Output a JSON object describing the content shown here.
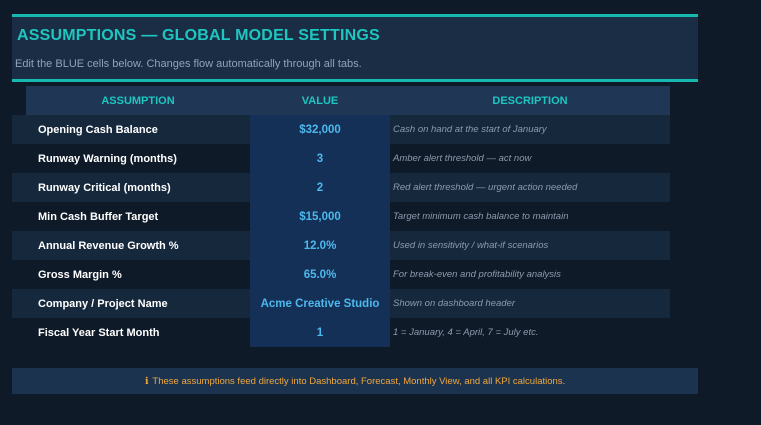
{
  "header": {
    "title": "ASSUMPTIONS  —  GLOBAL MODEL SETTINGS",
    "subtitle": "Edit the BLUE cells below. Changes flow automatically through all tabs."
  },
  "table": {
    "columns": {
      "assumption": "ASSUMPTION",
      "value": "VALUE",
      "description": "DESCRIPTION"
    },
    "rows": [
      {
        "label": "Opening Cash Balance",
        "value": "$32,000",
        "description": "Cash on hand at the start of January"
      },
      {
        "label": "Runway Warning (months)",
        "value": "3",
        "description": "Amber alert threshold — act now"
      },
      {
        "label": "Runway Critical (months)",
        "value": "2",
        "description": "Red alert threshold — urgent action needed"
      },
      {
        "label": "Min Cash Buffer Target",
        "value": "$15,000",
        "description": "Target minimum cash balance to maintain"
      },
      {
        "label": "Annual Revenue Growth %",
        "value": "12.0%",
        "description": "Used in sensitivity / what-if scenarios"
      },
      {
        "label": "Gross Margin %",
        "value": "65.0%",
        "description": "For break-even and profitability analysis"
      },
      {
        "label": "Company / Project Name",
        "value": "Acme Creative Studio",
        "description": "Shown on dashboard header"
      },
      {
        "label": "Fiscal Year Start Month",
        "value": "1",
        "description": "1 = January, 4 = April, 7 = July etc."
      }
    ]
  },
  "note": {
    "icon": "info-icon",
    "glyph": "ℹ",
    "text": "These assumptions feed directly into Dashboard, Forecast, Monthly View, and all KPI calculations."
  },
  "colors": {
    "accent": "#1ec6c0",
    "input_value": "#4cb8ee",
    "note_text": "#f0a83a",
    "background": "#0e1a28"
  }
}
